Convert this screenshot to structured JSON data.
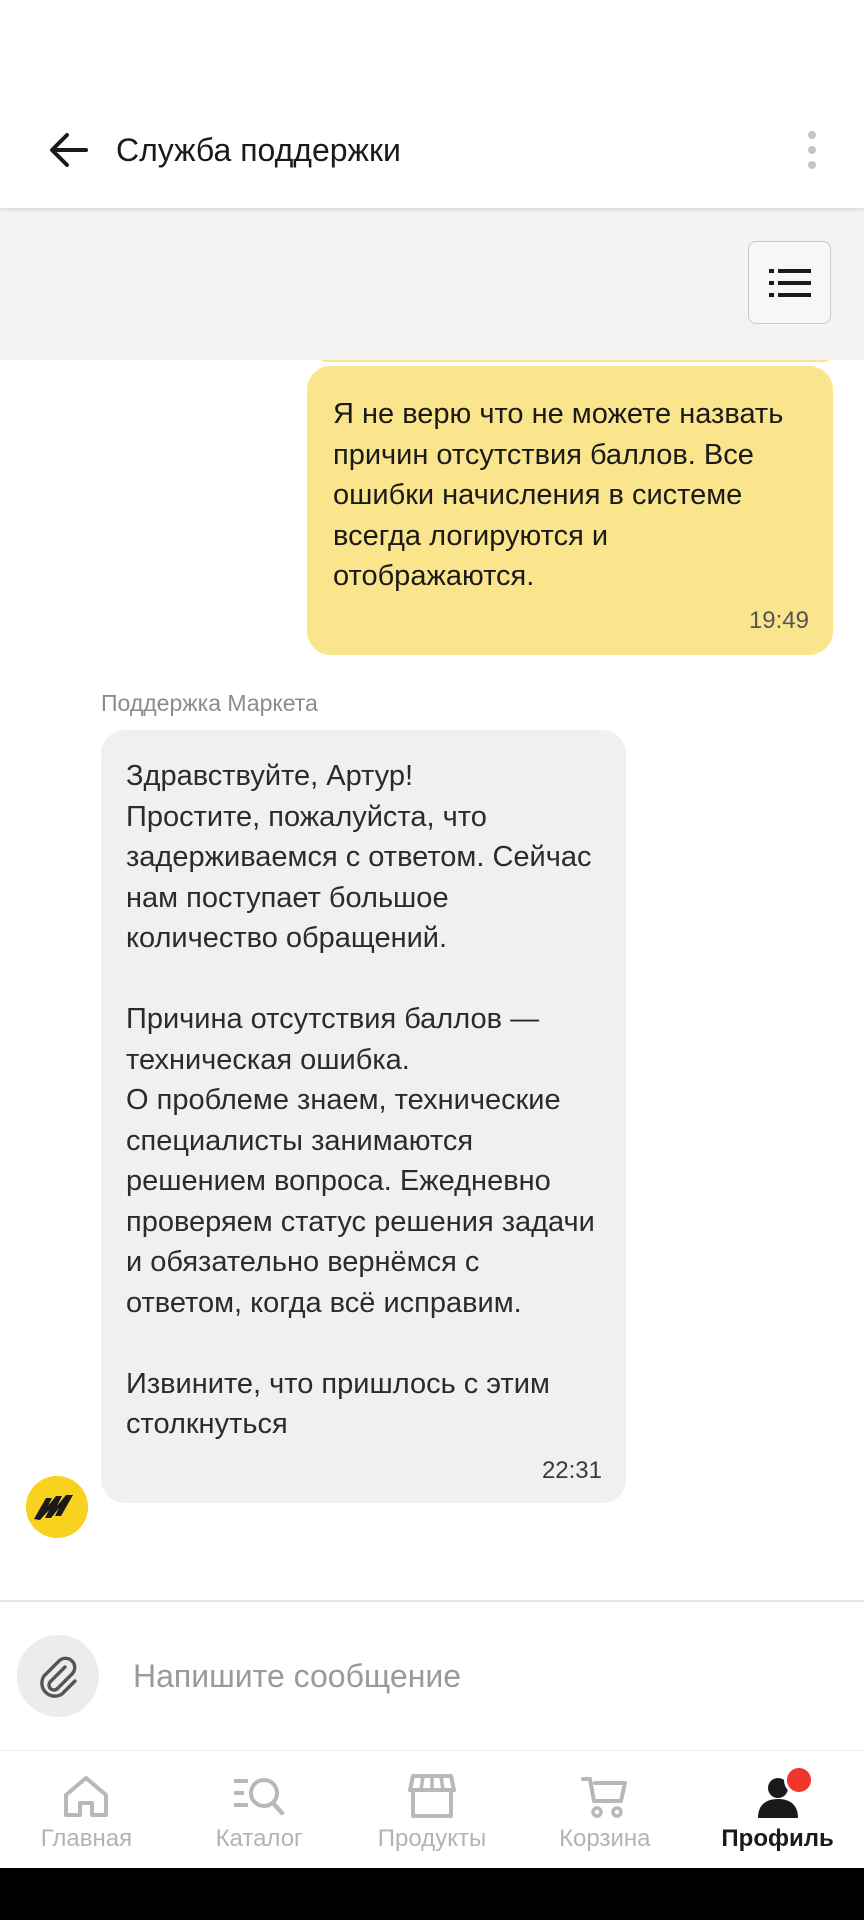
{
  "header": {
    "title": "Служба поддержки"
  },
  "chat": {
    "outgoing": {
      "text": "Я не верю что не можете назвать причин отсутствия баллов. Все ошибки начисления в системе всегда логируются и отображаются.",
      "time": "19:49"
    },
    "incoming": {
      "sender": "Поддержка Маркета",
      "text": "Здравствуйте, Артур!\nПростите, пожалуйста, что задерживаемся с ответом. Сейчас нам поступает большое количество обращений.\n\nПричина отсутствия баллов — техническая ошибка.\nО проблеме знаем, технические специалисты занимаются решением вопроса. Ежедневно проверяем статус решения задачи и обязательно вернёмся с ответом, когда всё исправим.\n\nИзвините, что пришлось с этим столкнуться",
      "time": "22:31"
    }
  },
  "composer": {
    "placeholder": "Напишите сообщение"
  },
  "nav": {
    "items": [
      {
        "label": "Главная",
        "icon": "home-icon"
      },
      {
        "label": "Каталог",
        "icon": "catalog-search-icon"
      },
      {
        "label": "Продукты",
        "icon": "store-icon"
      },
      {
        "label": "Корзина",
        "icon": "cart-icon"
      },
      {
        "label": "Профиль",
        "icon": "profile-icon"
      }
    ],
    "active": "Профиль"
  },
  "colors": {
    "outgoing_bubble": "#fae58c",
    "incoming_bubble": "#f1f0ef",
    "badge": "#f0352b",
    "avatar_bg": "#f8d21e"
  }
}
